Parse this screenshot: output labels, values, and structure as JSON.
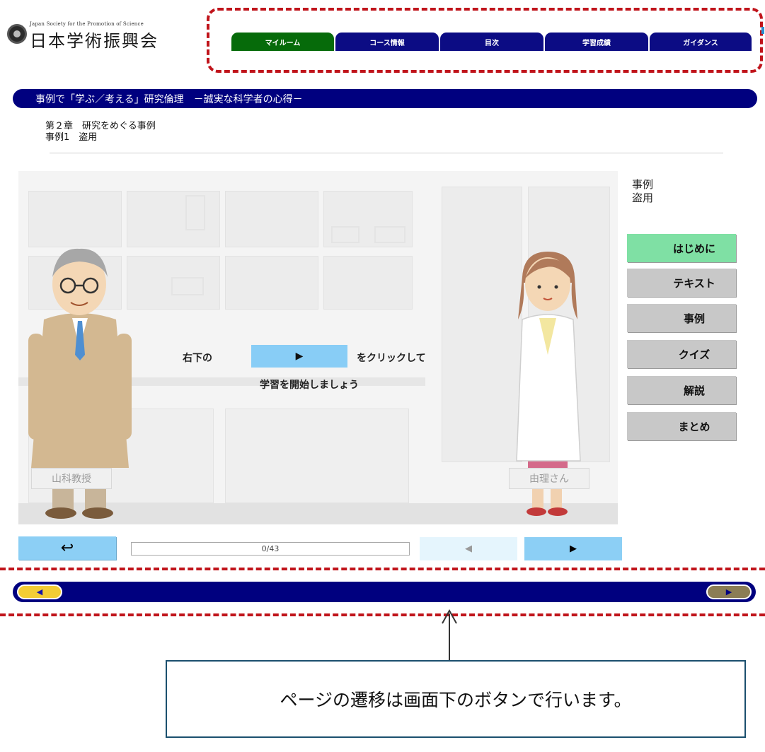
{
  "header": {
    "logo_subtitle": "Japan Society for the Promotion of Science",
    "logo_title": "日本学術振興会"
  },
  "nav": {
    "tabs": [
      {
        "label": "マイルーム",
        "active": true
      },
      {
        "label": "コース情報",
        "active": false
      },
      {
        "label": "目次",
        "active": false
      },
      {
        "label": "学習成績",
        "active": false
      },
      {
        "label": "ガイダンス",
        "active": false
      }
    ]
  },
  "title_bar": "事例で「学ぶ／考える」研究倫理　－誠実な科学者の心得－",
  "chapter": {
    "chapter_label": "第２章　研究をめぐる事例",
    "case_label": "事例1　盗用"
  },
  "stage": {
    "instruction_prefix": "右下の",
    "instruction_button_icon": "▶",
    "instruction_suffix": "をクリックして",
    "instruction_line2": "学習を開始しましょう",
    "professor_name": "山科教授",
    "student_name": "由理さん"
  },
  "side_menu": {
    "heading_line1": "事例",
    "heading_line2": "盗用",
    "items": [
      {
        "label": "はじめに",
        "active": true
      },
      {
        "label": "テキスト",
        "active": false
      },
      {
        "label": "事例",
        "active": false
      },
      {
        "label": "クイズ",
        "active": false
      },
      {
        "label": "解説",
        "active": false
      },
      {
        "label": "まとめ",
        "active": false
      }
    ]
  },
  "controls": {
    "back_icon": "return-arrow-icon",
    "back_glyph": "↩",
    "progress_text": "0/43",
    "prev_glyph": "◀",
    "next_glyph": "▶"
  },
  "bottom_nav": {
    "prev_glyph": "◀",
    "next_glyph": "▶"
  },
  "callout": {
    "text": "ページの遷移は画面下のボタンで行います。"
  },
  "colors": {
    "navy": "#00007f",
    "nav_active": "#066b0a",
    "menu_active": "#7fe0a4",
    "menu_inactive": "#c8c8c8",
    "control_blue": "#8ccff5",
    "highlight_frame": "#c0141b"
  }
}
